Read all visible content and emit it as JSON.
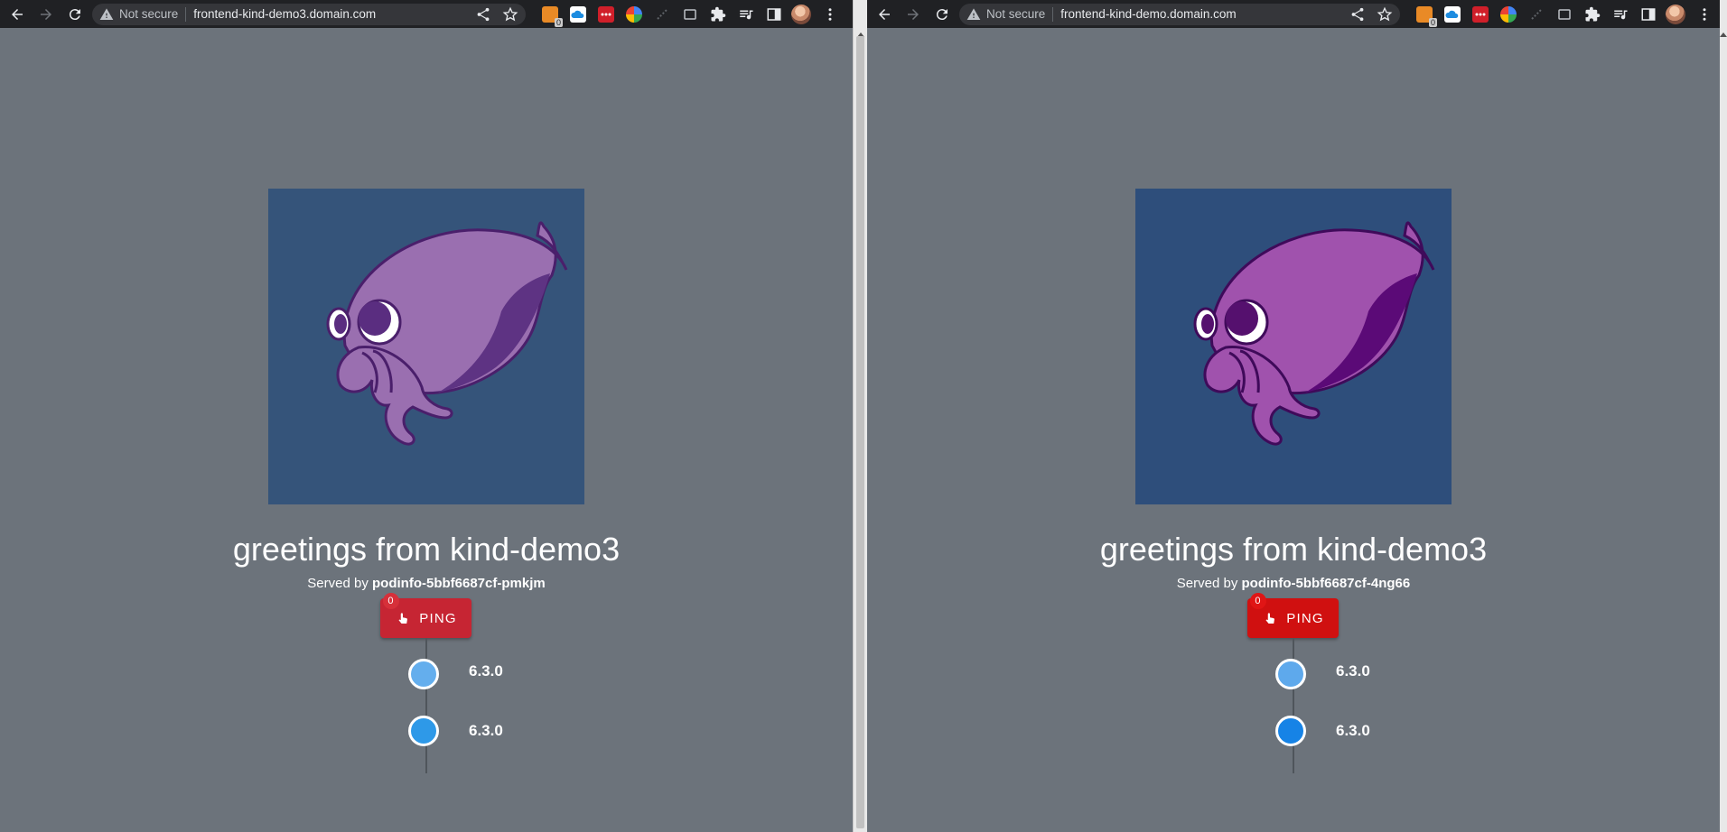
{
  "windows": {
    "left": {
      "security_label": "Not secure",
      "url": "frontend-kind-demo3.domain.com",
      "greeting": "greetings from kind-demo3",
      "served_prefix": "Served by",
      "pod_name": "podinfo-5bbf6687cf-pmkjm",
      "ping_label": "PING",
      "ping_count": "0",
      "versions": [
        "6.3.0",
        "6.3.0"
      ],
      "colors": {
        "logo_bg": "#35547a",
        "ping_button": "#c62533",
        "ping_badge": "#d6303a",
        "dot1": "#64aeed",
        "dot2": "#2e99e8",
        "octopus_body": "#9a6fb0",
        "octopus_shadow": "#5e3383"
      }
    },
    "right": {
      "security_label": "Not secure",
      "url": "frontend-kind-demo.domain.com",
      "greeting": "greetings from kind-demo3",
      "served_prefix": "Served by",
      "pod_name": "podinfo-5bbf6687cf-4ng66",
      "ping_label": "PING",
      "ping_count": "0",
      "versions": [
        "6.3.0",
        "6.3.0"
      ],
      "colors": {
        "logo_bg": "#2e4e7b",
        "ping_button": "#d01010",
        "ping_badge": "#e01515",
        "dot1": "#5ea9ec",
        "dot2": "#1683e6",
        "octopus_body": "#a052ad",
        "octopus_shadow": "#5b0a77"
      }
    }
  },
  "toolbar_icons": [
    "back-arrow-icon",
    "forward-arrow-icon",
    "reload-icon",
    "warning-icon",
    "share-icon",
    "star-icon",
    "extension-icons",
    "puzzle-icon",
    "media-icon",
    "side-panel-icon",
    "avatar",
    "menu-icon"
  ],
  "extension_badge": "0"
}
